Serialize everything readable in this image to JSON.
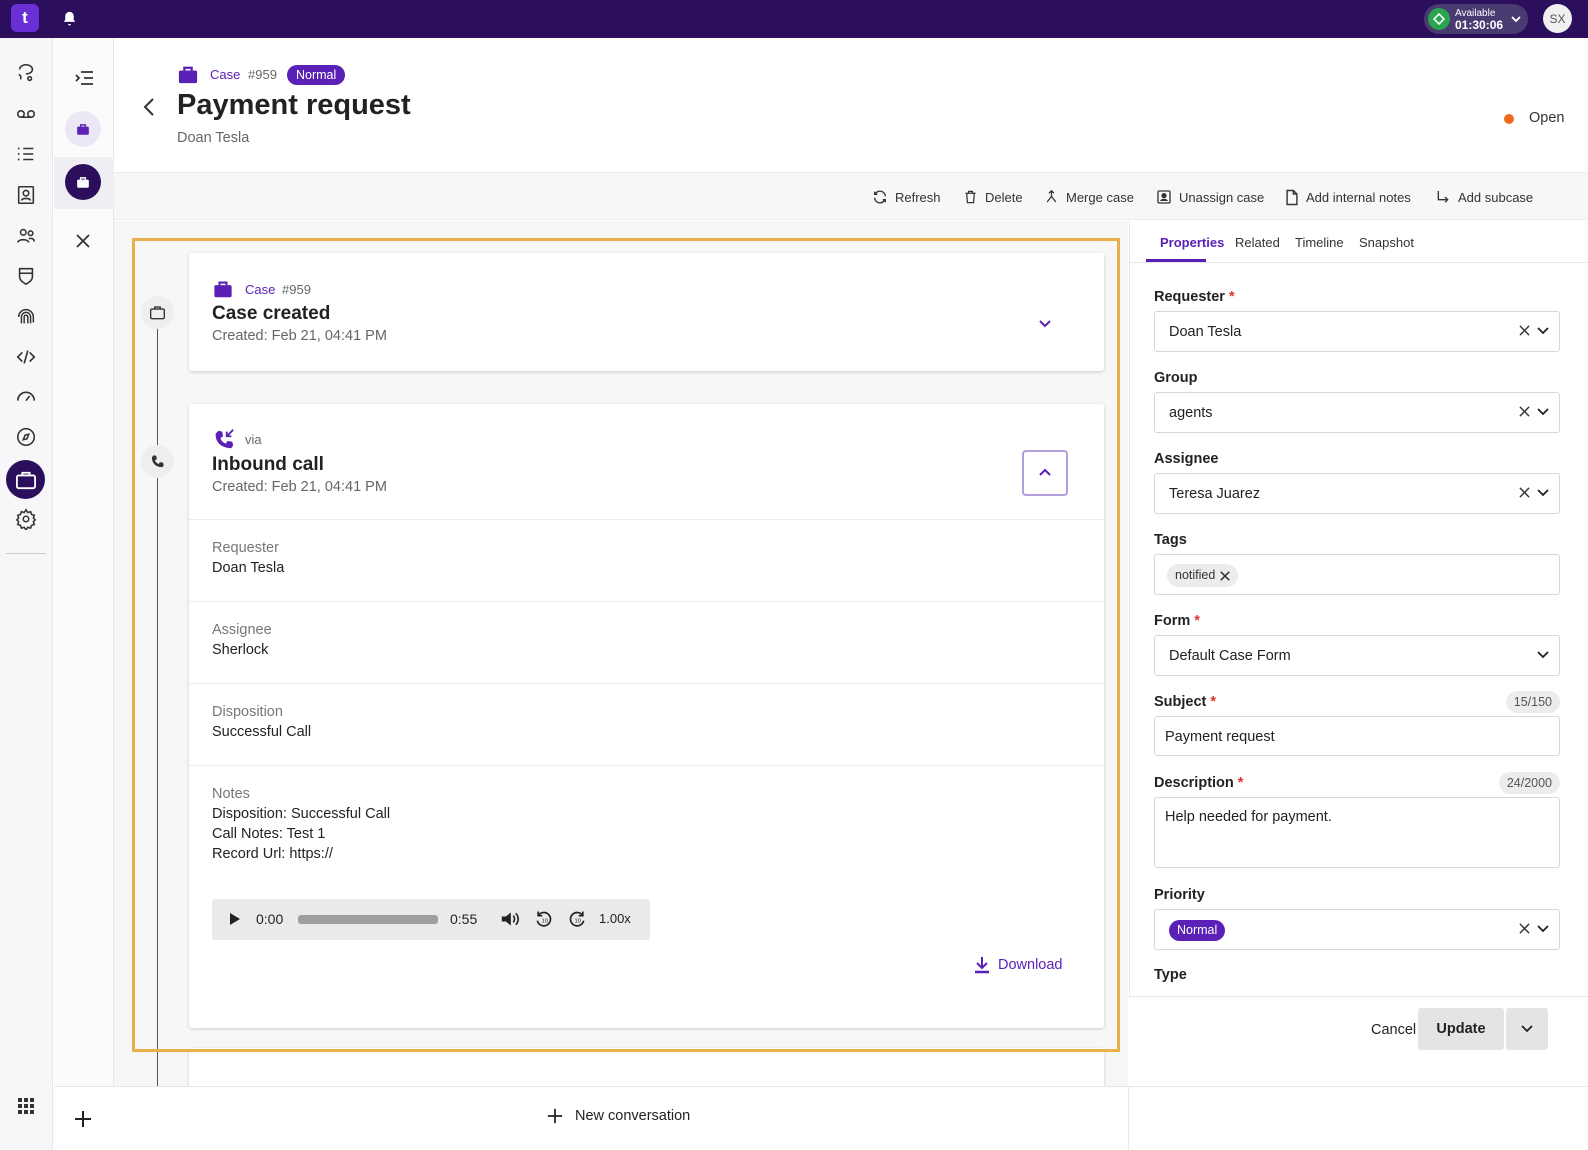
{
  "app": {
    "logo_text": "t",
    "status_label": "Available",
    "status_timer": "01:30:06",
    "user_initials": "SX"
  },
  "header": {
    "case_link": "Case",
    "case_number": "#959",
    "priority_badge": "Normal",
    "title": "Payment request",
    "subtitle": "Doan Tesla",
    "status": "Open"
  },
  "toolbar": {
    "refresh": "Refresh",
    "delete": "Delete",
    "merge": "Merge case",
    "unassign": "Unassign case",
    "add_notes": "Add internal notes",
    "add_subcase": "Add subcase"
  },
  "timeline": {
    "case_card": {
      "type_label": "Case",
      "number": "#959",
      "title": "Case created",
      "created": "Created: Feb 21, 04:41 PM"
    },
    "call_card": {
      "via": "via",
      "title": "Inbound call",
      "created": "Created: Feb 21, 04:41 PM",
      "fields": [
        {
          "label": "Requester",
          "value": "Doan Tesla"
        },
        {
          "label": "Assignee",
          "value": "Sherlock"
        },
        {
          "label": "Disposition",
          "value": "Successful Call"
        }
      ],
      "notes_label": "Notes",
      "notes_lines": [
        "Disposition: Successful Call",
        "Call Notes: Test 1",
        "Record Url: https://"
      ],
      "audio": {
        "current": "0:00",
        "duration": "0:55",
        "speed": "1.00x",
        "progress": 0
      },
      "download": "Download"
    }
  },
  "bottom": {
    "new_conversation": "New conversation"
  },
  "right_panel": {
    "tabs": [
      "Properties",
      "Related",
      "Timeline",
      "Snapshot"
    ],
    "requester_label": "Requester",
    "requester_value": "Doan Tesla",
    "group_label": "Group",
    "group_value": "agents",
    "assignee_label": "Assignee",
    "assignee_value": "Teresa Juarez",
    "tags_label": "Tags",
    "tag": "notified",
    "form_label": "Form",
    "form_value": "Default Case Form",
    "subject_label": "Subject",
    "subject_counter": "15/150",
    "subject_value": "Payment request",
    "description_label": "Description",
    "description_counter": "24/2000",
    "description_value": "Help needed for payment.",
    "priority_label": "Priority",
    "priority_value": "Normal",
    "type_label": "Type",
    "required_mark": "*",
    "cancel": "Cancel",
    "update": "Update"
  },
  "colors": {
    "brand": "#2b0f5c",
    "accent": "#5b21b6",
    "status_open": "#ee6b1e",
    "highlight": "#e8b04b"
  },
  "icons": [
    "bell-icon",
    "briefcase-icon",
    "phone-icon",
    "phone-incoming-icon",
    "refresh-icon",
    "trash-icon",
    "merge-icon",
    "unassign-icon",
    "note-icon",
    "subcase-icon",
    "download-icon",
    "play-icon",
    "volume-icon",
    "plus-icon",
    "grid-icon"
  ]
}
